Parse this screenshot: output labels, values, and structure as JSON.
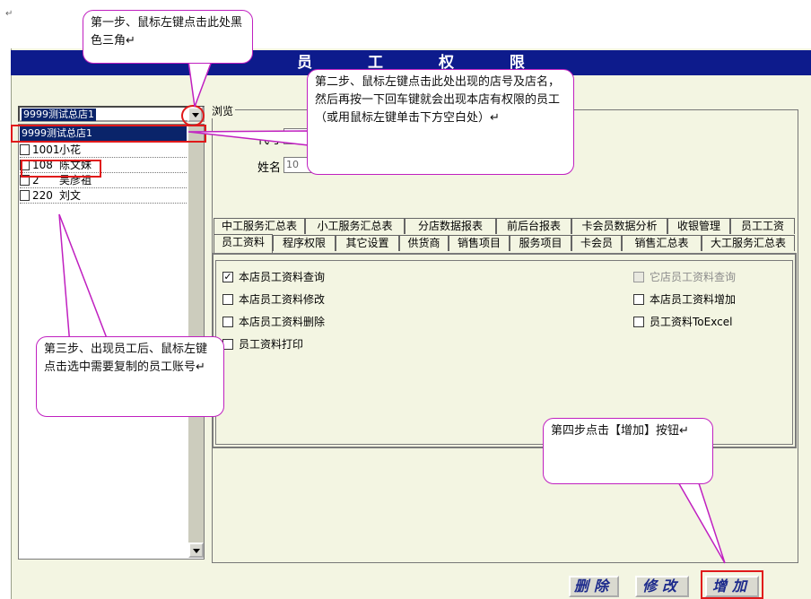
{
  "window": {
    "title": "员 工 权 限",
    "para_mark": "↵"
  },
  "store_selector": {
    "value": "9999测试总店1",
    "selected_option": "9999测试总店1"
  },
  "employees": [
    {
      "id": "1001",
      "name": "小花"
    },
    {
      "id": "108",
      "name": "陈文妹"
    },
    {
      "id": "2",
      "name": "吴彦祖"
    },
    {
      "id": "220",
      "name": "刘文"
    }
  ],
  "browse_group": {
    "title": "浏览",
    "code_label": "代号",
    "name_label": "姓名",
    "name_value": "10"
  },
  "tabs_row1": [
    "中工服务汇总表",
    "小工服务汇总表",
    "分店数据报表",
    "前后台报表",
    "卡会员数据分析",
    "收银管理",
    "员工工资"
  ],
  "tabs_row2": [
    "员工资料",
    "程序权限",
    "其它设置",
    "供货商",
    "销售项目",
    "服务项目",
    "卡会员",
    "销售汇总表",
    "大工服务汇总表"
  ],
  "active_tab": "员工资料",
  "permissions": {
    "left": [
      {
        "label": "本店员工资料查询",
        "checked": true
      },
      {
        "label": "本店员工资料修改",
        "checked": false
      },
      {
        "label": "本店员工资料删除",
        "checked": false
      },
      {
        "label": "员工资料打印",
        "checked": false
      }
    ],
    "right": [
      {
        "label": "它店员工资料查询",
        "checked": false,
        "disabled": true
      },
      {
        "label": "本店员工资料增加",
        "checked": false
      },
      {
        "label": "员工资料ToExcel",
        "checked": false
      }
    ]
  },
  "buttons": {
    "delete": "删除",
    "modify": "修改",
    "add": "增加"
  },
  "callouts": {
    "step1": "第一步、鼠标左键点击此处黑色三角↵",
    "step2": "第二步、鼠标左键点击此处出现的店号及店名，然后再按一下回车键就会出现本店有权限的员工（或用鼠标左键单击下方空白处）↵",
    "step3": "第三步、出现员工后、鼠标左键点击选中需要复制的员工账号↵",
    "step4": "第四步点击【增加】按钮↵"
  },
  "colors": {
    "title_bar": "#0d1b8c",
    "panel_bg": "#f3f5e2",
    "highlight_red": "#e0191a",
    "callout_border": "#c020c0",
    "selection": "#0a246a"
  }
}
